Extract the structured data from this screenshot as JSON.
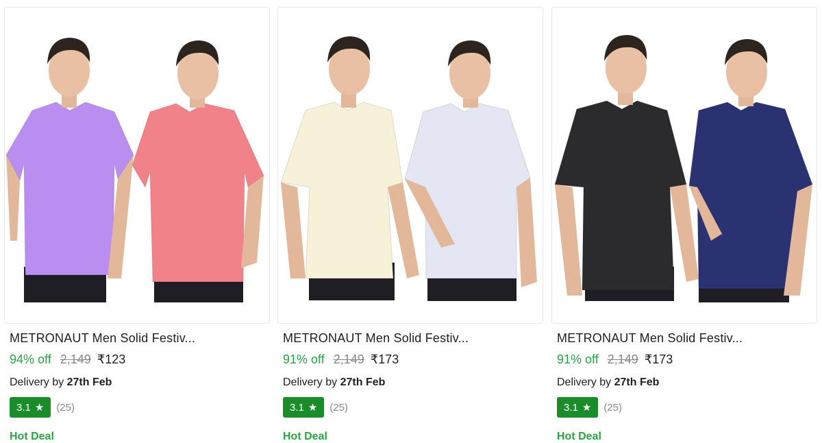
{
  "products": [
    {
      "title": "METRONAUT Men Solid Festiv...",
      "discount": "94% off",
      "mrp": "2,149",
      "price": "₹123",
      "delivery_prefix": "Delivery by",
      "delivery_date": "27th Feb",
      "rating": "3.1",
      "reviews": "(25)",
      "deal": "Hot Deal",
      "shirt_colors": [
        "#b98ef0",
        "#f2828a"
      ],
      "image_description": "Two models wearing purple and pink short-sleeve shirts"
    },
    {
      "title": "METRONAUT Men Solid Festiv...",
      "discount": "91% off",
      "mrp": "2,149",
      "price": "₹173",
      "delivery_prefix": "Delivery by",
      "delivery_date": "27th Feb",
      "rating": "3.1",
      "reviews": "(25)",
      "deal": "Hot Deal",
      "shirt_colors": [
        "#f6f1d9",
        "#e4e6f3"
      ],
      "image_description": "Two models wearing cream and light blue short-sleeve shirts"
    },
    {
      "title": "METRONAUT Men Solid Festiv...",
      "discount": "91% off",
      "mrp": "2,149",
      "price": "₹173",
      "delivery_prefix": "Delivery by",
      "delivery_date": "27th Feb",
      "rating": "3.1",
      "reviews": "(25)",
      "deal": "Hot Deal",
      "shirt_colors": [
        "#2b2b2e",
        "#2a3272"
      ],
      "image_description": "Two models wearing black and navy short-sleeve shirts"
    }
  ],
  "colors": {
    "discount_green": "#26a541",
    "rating_badge": "#1b8c2a",
    "muted_gray": "#878787"
  },
  "icons": {
    "rating": "star-icon"
  }
}
